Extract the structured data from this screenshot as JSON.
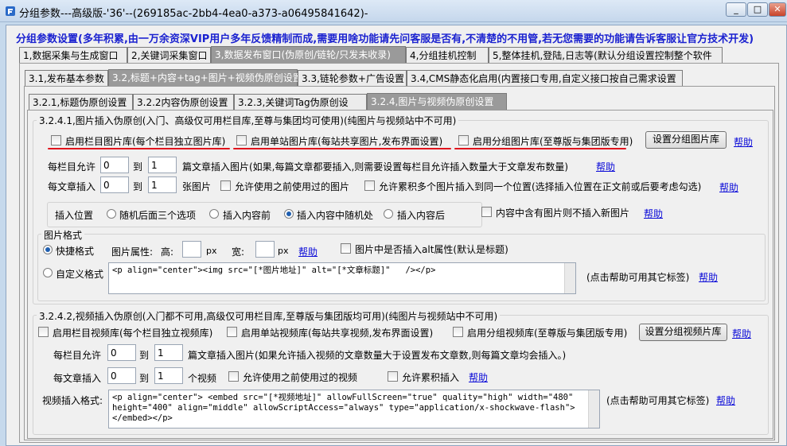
{
  "window": {
    "title": "分组参数---高级版-'36'--(269185ac-2bb4-4ea0-a373-a06495841642)-",
    "minimize": "_",
    "maximize": "□",
    "close": "✕"
  },
  "notice": "分组参数设置(多年积累,由一万余资深VIP用户多年反馈精制而成,需要用啥功能请先问客服是否有,不清楚的不用管,若无您需要的功能请告诉客服让官方技术开发)",
  "main_tabs": [
    "1,数据采集与生成窗口",
    "2,关键词采集窗口",
    "3,数据发布窗口(伪原创/链轮/只发未收录)",
    "4,分组挂机控制",
    "5,整体挂机,登陆,日志等(默认分组设置控制整个软件"
  ],
  "sub_tabs": [
    "3.1,发布基本参数",
    "3.2,标题+内容+tag+图片+视频伪原创设置",
    "3.3,链轮参数+广告设置",
    "3.4,CMS静态化启用(内置接口专用,自定义接口按自己需求设置"
  ],
  "sub_sub_tabs": [
    "3.2.1,标题伪原创设置",
    "3.2.2内容伪原创设置",
    "3.2.3,关键词Tag伪原创设",
    "3.2.4,图片与视频伪原创设置"
  ],
  "image_section": {
    "title": "3.2.4.1,图片插入伪原创(入门、高级仅可用栏目库,至尊与集团均可使用)(纯图片与视频站中不可用)",
    "opt_column": "启用栏目图片库(每个栏目独立图片库)",
    "opt_site": "启用单站图片库(每站共享图片,发布界面设置)",
    "opt_group": "启用分组图片库(至尊版与集团版专用)",
    "btn_set_group": "设置分组图片库",
    "help": "帮助",
    "per_column_label": "每栏目允许",
    "per_column_from": "0",
    "to": "到",
    "per_column_to": "1",
    "per_column_desc": "篇文章插入图片(如果,每篇文章都要插入,则需要设置每栏目允许插入数量大于文章发布数量)",
    "per_article_label": "每文章插入",
    "per_article_from": "0",
    "per_article_to": "1",
    "per_article_unit": "张图片",
    "allow_used": "允许使用之前使用过的图片",
    "allow_multi": "允许累积多个图片插入到同一个位置(选择插入位置在正文前或后要考虑勾选)",
    "position_label": "插入位置",
    "pos_options": [
      "随机后面三个选项",
      "插入内容前",
      "插入内容中随机处",
      "插入内容后"
    ],
    "pos_selected_index": 2,
    "skip_if_has_image": "内容中含有图片则不插入新图片",
    "format_group_title": "图片格式",
    "fast_format": "快捷格式",
    "img_attr": "图片属性:",
    "height_label": "高:",
    "height_value": "",
    "px": "px",
    "width_label": "宽:",
    "width_value": "",
    "alt_option": "图片中是否插入alt属性(默认是标题)",
    "custom_format": "自定义格式",
    "custom_template": "<p align=\"center\"><img src=\"[*图片地址]\" alt=\"[*文章标题]\"   /></p>",
    "custom_hint": "(点击帮助可用其它标签)"
  },
  "video_section": {
    "title": "3.2.4.2,视频插入伪原创(入门都不可用,高级仅可用栏目库,至尊版与集团版均可用)(纯图片与视频站中不可用)",
    "opt_column": "启用栏目视频库(每个栏目独立视频库)",
    "opt_site": "启用单站视频库(每站共享视频,发布界面设置)",
    "opt_group": "启用分组视频库(至尊版与集团版专用)",
    "btn_set_group": "设置分组视频片库",
    "help": "帮助",
    "per_column_label": "每栏目允许",
    "per_column_from": "0",
    "to": "到",
    "per_column_to": "1",
    "per_column_desc": "篇文章插入图片(如果允许插入视频的文章数量大于设置发布文章数,则每篇文章均会插入。)",
    "per_article_label": "每文章插入",
    "per_article_from": "0",
    "per_article_to": "1",
    "per_article_unit": "个视频",
    "allow_used": "允许使用之前使用过的视频",
    "allow_multi": "允许累积插入",
    "format_label": "视频插入格式:",
    "template": "<p align=\"center\"> <embed src=\"[*视频地址]\" allowFullScreen=\"true\" quality=\"high\" width=\"480\" height=\"400\" align=\"middle\" allowScriptAccess=\"always\" type=\"application/x-shockwave-flash\"></embed></p>",
    "hint": "(点击帮助可用其它标签)"
  },
  "colors": {
    "accent_text": "#1b22d0",
    "highlight_underline": "#e0141d",
    "selected_tab": "#9a9a9a"
  }
}
